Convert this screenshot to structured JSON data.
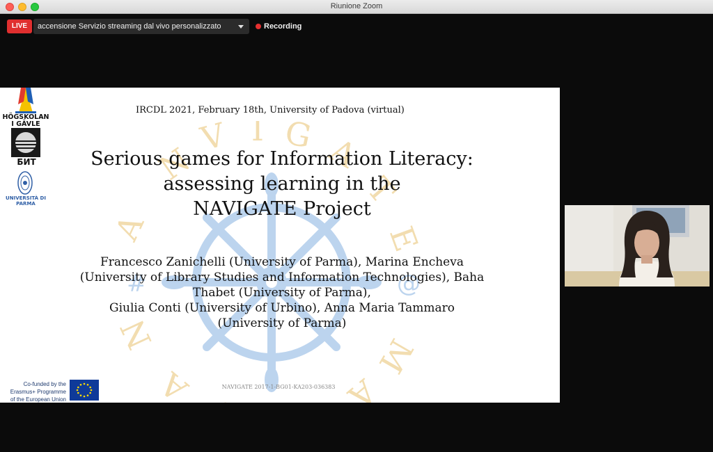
{
  "window": {
    "title": "Riunione Zoom"
  },
  "toolbar": {
    "live_label": "LIVE",
    "stream_select_value": "accensione Servizio streaming dal vivo personalizzato",
    "recording_label": "Recording"
  },
  "slide": {
    "conference": "IRCDL 2021, February 18th, University of Padova (virtual)",
    "title_lines": [
      "Serious games for Information Literacy:",
      "assessing learning in the",
      "NAVIGATE Project"
    ],
    "author_lines": [
      "Francesco Zanichelli (University of Parma), Marina Encheva",
      "(University of Library Studies and Information Technologies), Baha",
      "Thabet (University of Parma),",
      "Giulia Conti (University of Urbino), Anna Maria Tammaro",
      "(University of Parma)"
    ],
    "project_code": "NAVIGATE 2017-1-BG01-KA203-036383",
    "logos": {
      "hig_line1": "HÖGSKOLAN",
      "hig_line2": "I GÄVLE",
      "bit": "БИТ",
      "parma": "UNIVERSITÀ DI PARMA"
    },
    "eu_lines": [
      "Co-funded by the",
      "Erasmus+ Programme",
      "of the European Union"
    ]
  },
  "colors": {
    "live_red": "#e02f2f",
    "recording_dot": "#e53030",
    "watermark_blue": "#a9c7e8",
    "watermark_gold": "#f0d9a8",
    "eu_blue": "#0f3a99",
    "eu_star": "#ffdd00"
  }
}
